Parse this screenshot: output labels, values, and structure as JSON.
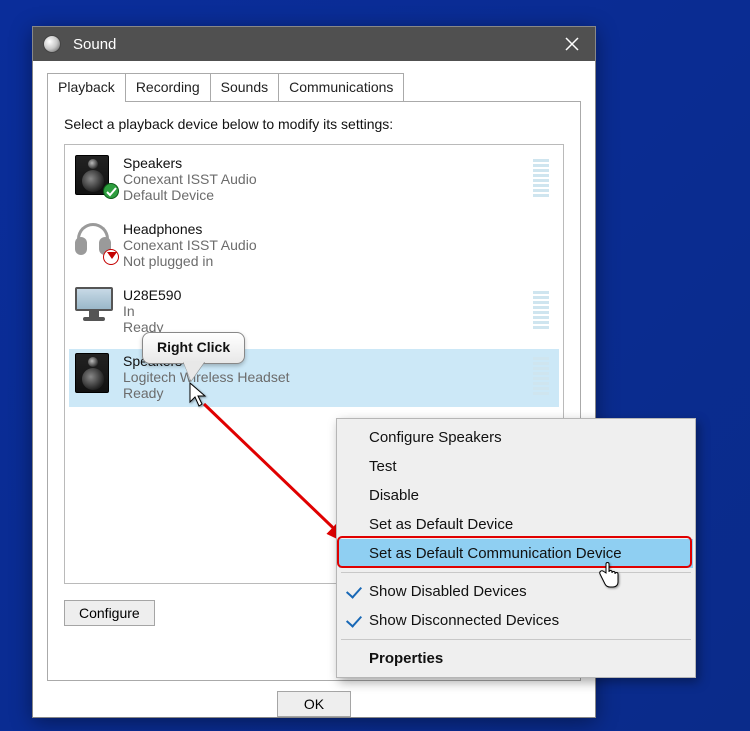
{
  "window": {
    "title": "Sound",
    "close_label": "Close"
  },
  "tabs": {
    "items": [
      "Playback",
      "Recording",
      "Sounds",
      "Communications"
    ],
    "active_index": 0
  },
  "instruction": "Select a playback device below to modify its settings:",
  "devices": [
    {
      "name": "Speakers",
      "subtitle": "Conexant ISST Audio",
      "status": "Default Device",
      "icon": "speaker",
      "badge": "check-green",
      "selected": false
    },
    {
      "name": "Headphones",
      "subtitle": "Conexant ISST Audio",
      "status": "Not plugged in",
      "icon": "headphones",
      "badge": "unplugged-red",
      "selected": false
    },
    {
      "name": "U28E590",
      "subtitle": "In",
      "status": "Ready",
      "icon": "monitor",
      "badge": "none",
      "selected": false
    },
    {
      "name": "Speakers",
      "subtitle": "Logitech Wireless Headset",
      "status": "Ready",
      "icon": "speaker",
      "badge": "none",
      "selected": true
    }
  ],
  "callout": {
    "text": "Right Click"
  },
  "context_menu": {
    "items": [
      {
        "label": "Configure Speakers",
        "checked": false,
        "highlight": false
      },
      {
        "label": "Test",
        "checked": false,
        "highlight": false
      },
      {
        "label": "Disable",
        "checked": false,
        "highlight": false
      },
      {
        "label": "Set as Default Device",
        "checked": false,
        "highlight": false
      },
      {
        "label": "Set as Default Communication Device",
        "checked": false,
        "highlight": true,
        "redbox": true
      }
    ],
    "items2": [
      {
        "label": "Show Disabled Devices",
        "checked": true
      },
      {
        "label": "Show Disconnected Devices",
        "checked": true
      }
    ],
    "items3": [
      {
        "label": "Properties",
        "bold": true
      }
    ]
  },
  "buttons": {
    "configure": "Configure",
    "ok": "OK"
  },
  "colors": {
    "selection_bg": "#cce8f7",
    "menu_highlight": "#8fcff2",
    "red_outline": "#e00000",
    "check_blue": "#1868b6"
  }
}
